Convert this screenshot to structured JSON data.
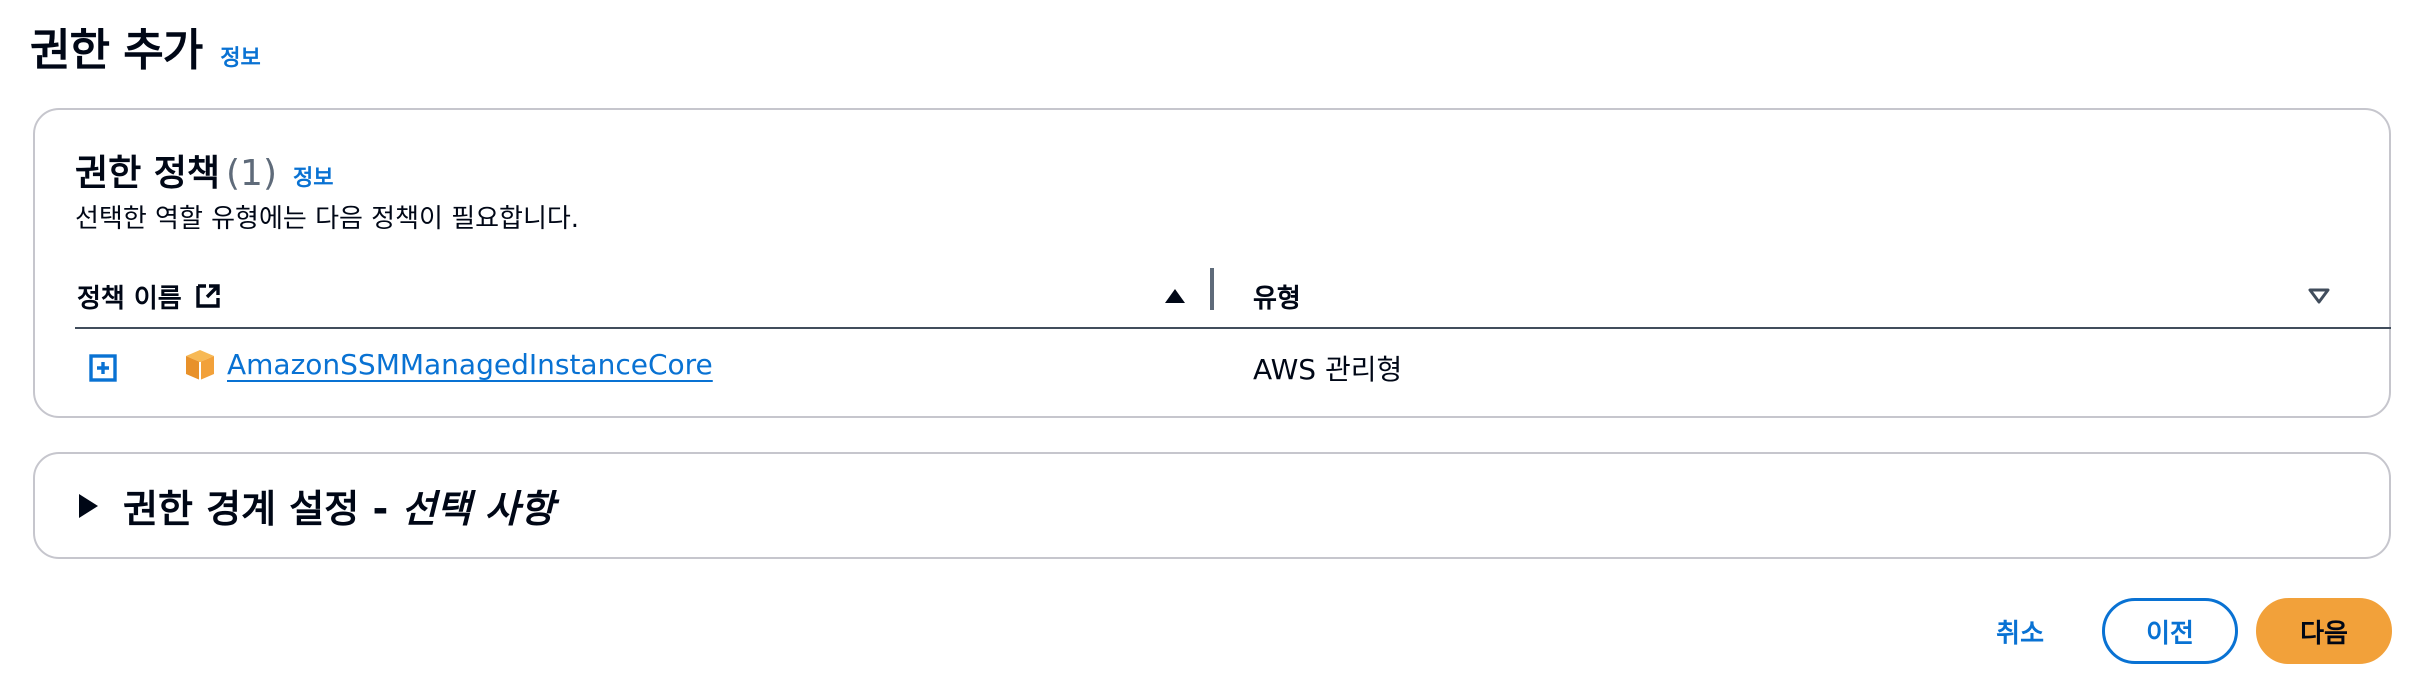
{
  "page": {
    "title": "권한 추가",
    "info": "정보"
  },
  "policies": {
    "title": "권한 정책",
    "count": "(1)",
    "info": "정보",
    "description": "선택한 역할 유형에는 다음 정책이 필요합니다.",
    "columns": {
      "name": "정책 이름",
      "type": "유형"
    },
    "rows": [
      {
        "name": "AmazonSSMManagedInstanceCore",
        "type": "AWS 관리형"
      }
    ]
  },
  "boundary": {
    "title": "권한 경계 설정 - ",
    "optional": "선택 사항"
  },
  "footer": {
    "cancel": "취소",
    "previous": "이전",
    "next": "다음"
  },
  "colors": {
    "link": "#0972d3",
    "primary": "#f2a13a",
    "border": "#c6c6cd",
    "text": "#000716",
    "muted": "#5f6b7a",
    "aws_icon": "#f2a13a"
  },
  "icons": {
    "external": "external-link-icon",
    "sort_asc": "sort-ascending-icon",
    "sort_none": "sort-descending-outline-icon",
    "expand": "expand-plus-icon",
    "policy": "aws-managed-cube-icon",
    "caret": "caret-right-icon"
  }
}
